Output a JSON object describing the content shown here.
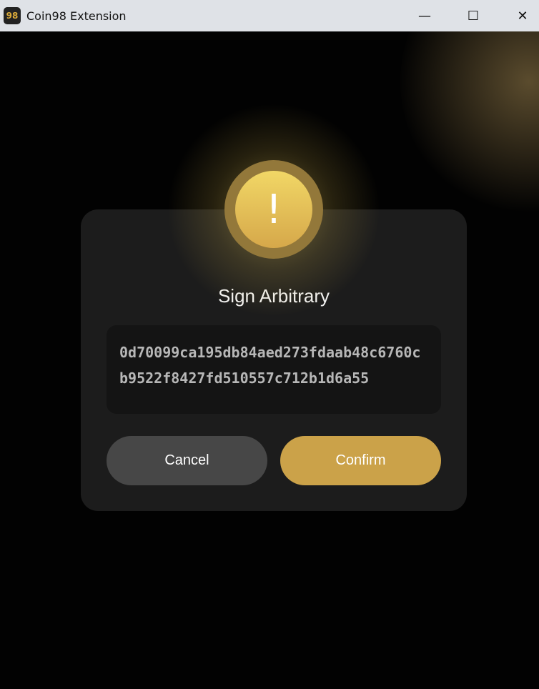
{
  "window": {
    "title": "Coin98 Extension",
    "app_icon_text": "98",
    "minimize": "—",
    "maximize": "☐",
    "close": "✕"
  },
  "dialog": {
    "icon": "exclamation-icon",
    "icon_glyph": "!",
    "title": "Sign Arbitrary",
    "message": "0d70099ca195db84aed273fdaab48c6760cb9522f8427fd510557c712b1d6a55",
    "cancel_label": "Cancel",
    "confirm_label": "Confirm"
  },
  "colors": {
    "accent": "#cba249",
    "card": "#1c1c1c",
    "cancel": "#474747"
  }
}
